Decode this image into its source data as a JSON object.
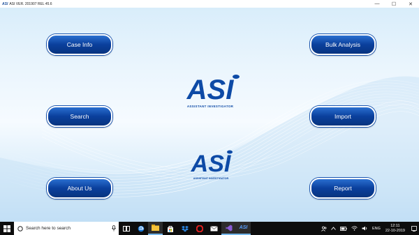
{
  "window": {
    "title_logo": "ASI",
    "title": "ASI VER. 201907 REL 45.6",
    "minimize": "—",
    "maximize": "☐",
    "close": "✕"
  },
  "buttons": {
    "case_info": "Case Info",
    "search": "Search",
    "about_us": "About Us",
    "bulk_analysis": "Bulk Analysis",
    "import": "Import",
    "report": "Report"
  },
  "logo": {
    "text": "ASI",
    "tagline_big": "ASSISTANT INVESTIGATOR",
    "tagline_small": "ASSISTANT INVESTIGATOR",
    "color": "#0d4aa6"
  },
  "taskbar": {
    "search_placeholder": "Search here to search",
    "apps": [
      "task-view-icon",
      "edge-icon",
      "file-explorer-icon",
      "store-icon",
      "dropbox-icon",
      "opera-icon",
      "mail-icon",
      "visual-studio-icon",
      "asi-app-icon"
    ],
    "language": "ENG",
    "time": "12:11",
    "date": "22-10-2019"
  }
}
